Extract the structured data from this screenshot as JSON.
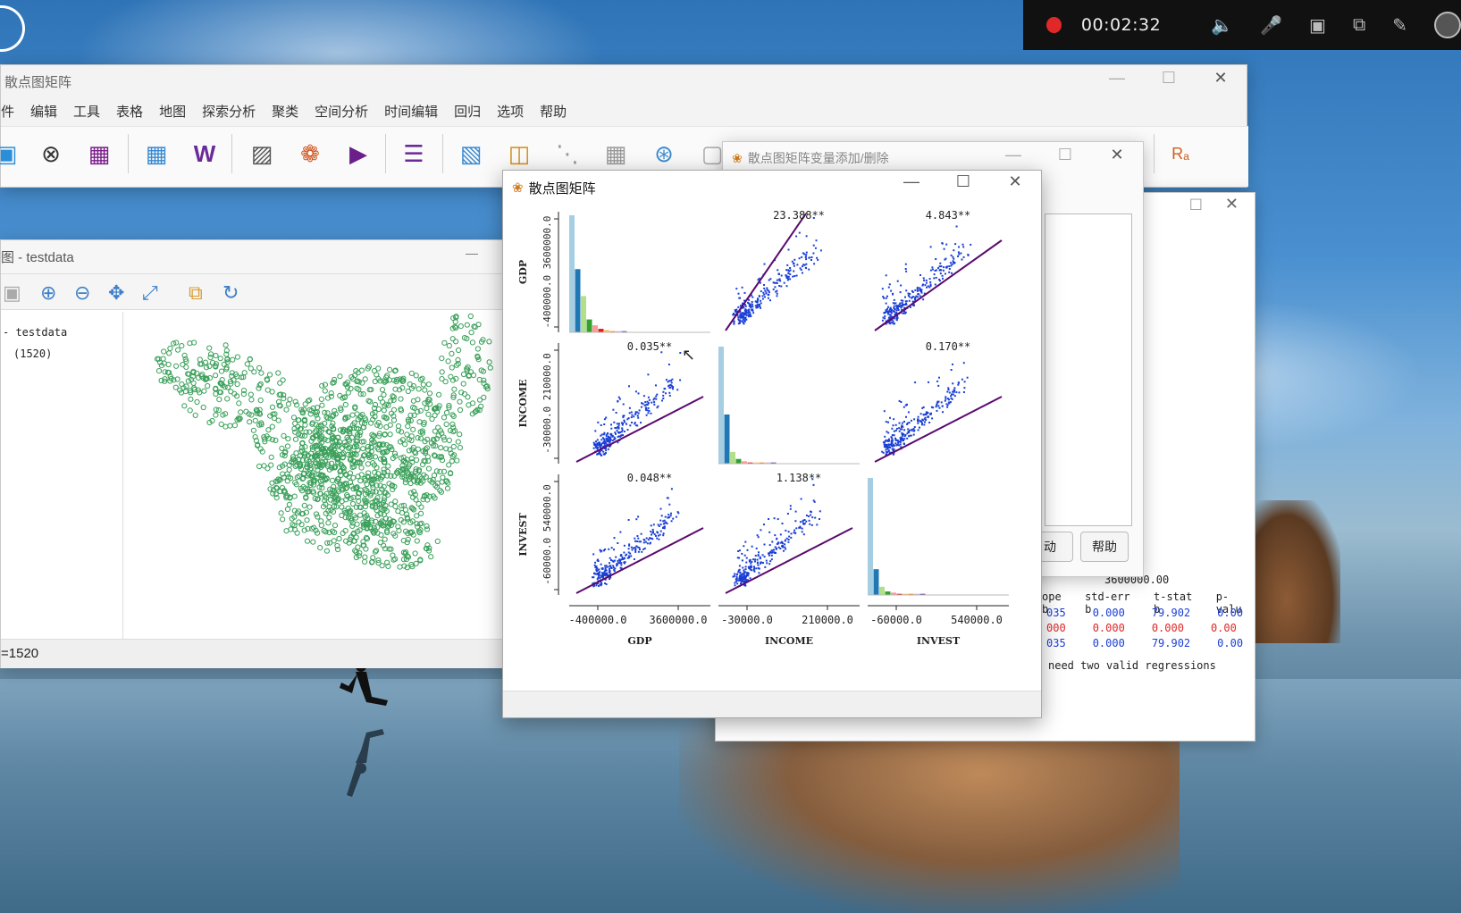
{
  "recorder": {
    "time": "00:02:32"
  },
  "main_window": {
    "title": "散点图矩阵",
    "menus": [
      "件",
      "编辑",
      "工具",
      "表格",
      "地图",
      "探索分析",
      "聚类",
      "空间分析",
      "时间编辑",
      "回归",
      "选项",
      "帮助"
    ]
  },
  "map_window": {
    "title": "图 - testdata",
    "layer_name": "- testdata",
    "layer_count": "(1520)",
    "status": "=1520",
    "point_color": "#3aa05a"
  },
  "var_window": {
    "title": "散点图矩阵变量添加/删除",
    "button_left": "动",
    "button_help": "帮助"
  },
  "result_window": {
    "axis_value": "3600000.00",
    "headers": [
      "ope b",
      "std-err b",
      "t-stat b",
      "p-valu"
    ],
    "rows": [
      {
        "color": "#1a3fd6",
        "values": [
          "035",
          "0.000",
          "79.902",
          "0.00"
        ]
      },
      {
        "color": "#e02828",
        "values": [
          "000",
          "0.000",
          "0.000",
          "0.00"
        ]
      },
      {
        "color": "#1a3fd6",
        "values": [
          "035",
          "0.000",
          "79.902",
          "0.00"
        ]
      }
    ],
    "note": "need two valid regressions"
  },
  "scatter_matrix": {
    "title": "散点图矩阵",
    "variables": [
      "GDP",
      "INCOME",
      "INVEST"
    ],
    "row_ticks": [
      [
        "-400000.0",
        "3600000.0"
      ],
      [
        "-30000.0",
        "210000.0"
      ],
      [
        "-60000.0",
        "540000.0"
      ]
    ],
    "col_ticks": [
      [
        "-400000.0",
        "3600000.0"
      ],
      [
        "-30000.0",
        "210000.0"
      ],
      [
        "-60000.0",
        "540000.0"
      ]
    ],
    "slope_labels": {
      "0_1": "23.388**",
      "0_2": "4.843**",
      "1_0": "0.035**",
      "1_2": "0.170**",
      "2_0": "0.048**",
      "2_1": "1.138**"
    },
    "colors": {
      "points": "#1a3fd6",
      "line": "#5a0a6e"
    }
  }
}
